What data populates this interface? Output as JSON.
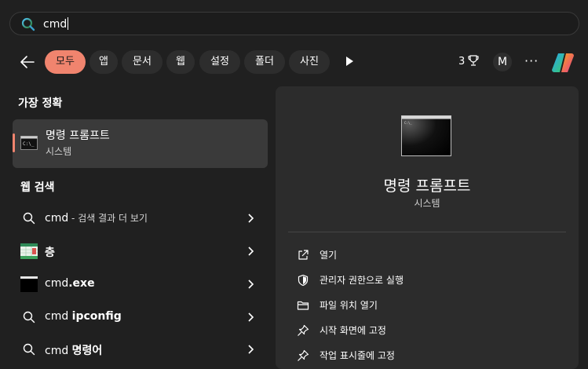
{
  "search": {
    "query": "cmd"
  },
  "filters": {
    "chips": [
      "모두",
      "앱",
      "문서",
      "웹",
      "설정",
      "폴더",
      "사진"
    ],
    "count": "3",
    "avatar_letter": "M",
    "more": "···"
  },
  "best_match": {
    "header": "가장 정확",
    "name": "명령 프롬프트",
    "type": "시스템"
  },
  "web": {
    "header": "웹 검색",
    "items": [
      {
        "prefix": "cmd",
        "suffix": " - 검색 결과 더 보기"
      },
      {
        "prefix": "",
        "bold": "층"
      },
      {
        "prefix": "cmd",
        "bold": ".exe"
      },
      {
        "prefix": "cmd ",
        "bold": "ipconfig"
      },
      {
        "prefix": "cmd ",
        "bold": "명령어"
      }
    ]
  },
  "detail": {
    "title": "명령 프롬프트",
    "subtitle": "시스템",
    "actions": [
      "열기",
      "관리자 권한으로 실행",
      "파일 위치 열기",
      "시작 화면에 고정",
      "작업 표시줄에 고정"
    ]
  },
  "colors": {
    "accent": "#f0846e",
    "background": "#202020",
    "panel": "#2c2c2c"
  }
}
